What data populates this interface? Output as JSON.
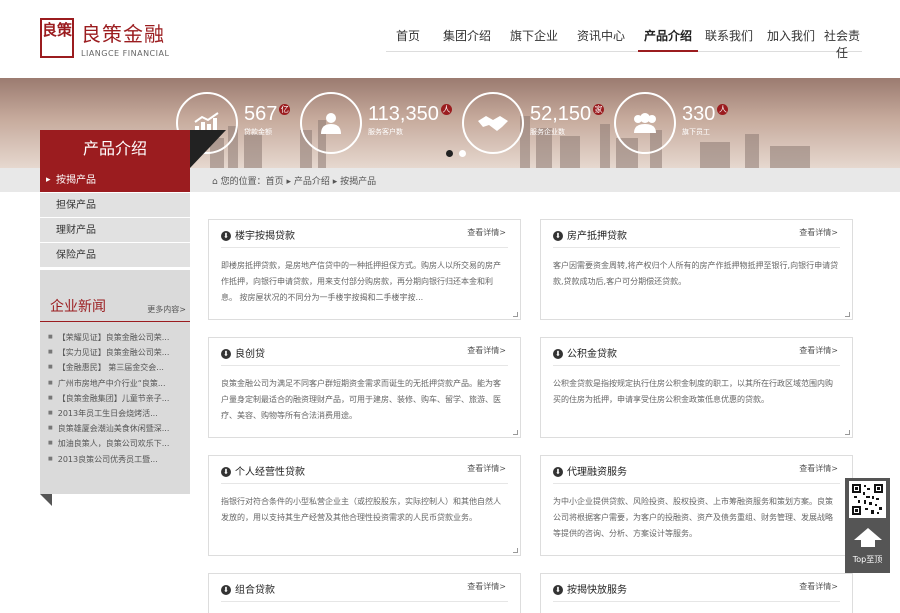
{
  "logo": {
    "seal": "良策",
    "name": "良策金融",
    "en": "LIANGCE FINANCIAL"
  },
  "nav": [
    {
      "label": "首页"
    },
    {
      "label": "集团介绍"
    },
    {
      "label": "旗下企业"
    },
    {
      "label": "资讯中心"
    },
    {
      "label": "产品介绍",
      "active": true
    },
    {
      "label": "联系我们"
    },
    {
      "label": "加入我们"
    },
    {
      "label": "社会责任"
    }
  ],
  "stats": [
    {
      "icon": "chart-icon",
      "value": "567",
      "unit": "亿",
      "label": "贷款金额"
    },
    {
      "icon": "person-icon",
      "value": "113,350",
      "unit": "人",
      "label": "服务客户数"
    },
    {
      "icon": "handshake-icon",
      "value": "52,150",
      "unit": "家",
      "label": "服务企业数"
    },
    {
      "icon": "group-icon",
      "value": "330",
      "unit": "人",
      "label": "旗下员工"
    }
  ],
  "breadcrumb": "您的位置：首页 ▸ 产品介绍 ▸ 按揭产品",
  "sidebar": {
    "title": "产品介绍",
    "items": [
      {
        "label": "按揭产品",
        "active": true
      },
      {
        "label": "担保产品"
      },
      {
        "label": "理财产品"
      },
      {
        "label": "保险产品"
      }
    ]
  },
  "news": {
    "title": "企业新闻",
    "more": "更多内容>",
    "items": [
      "【荣耀见证】良策金融公司荣...",
      "【实力见证】良策金融公司荣...",
      "【金融惠民】 第三届金交会...",
      "广州市房地产中介行业“良策...",
      "【良策金融集团】儿童节亲子...",
      "2013年员工生日会烧烤活...",
      "良策雄厦会潮汕美食休闲暨深...",
      "加油良策人，良策公司欢乐下...",
      "2013良策公司优秀员工暨..."
    ]
  },
  "cards": [
    {
      "title": "楼宇按揭贷款",
      "more": "查看详情>",
      "body": "即楼房抵押贷款，是房地产信贷中的一种抵押担保方式。购房人以所交易的房产作抵押，向银行申请贷款，用来支付部分购房款，再分期向银行归还本金和利息。 按房屋状况的不同分为一手楼宇按揭和二手楼宇按..."
    },
    {
      "title": "房产抵押贷款",
      "more": "查看详情>",
      "body": "客户因需要资金周转,将产权归个人所有的房产作抵押物抵押至银行,向银行申请贷款,贷款成功后,客户可分期偿还贷款。"
    },
    {
      "title": "良创贷",
      "more": "查看详情>",
      "body": "良策金融公司为满足不同客户群短期资金需求而诞生的无抵押贷款产品。能为客户量身定制最适合的融资理财产品，可用于建房、装修、购车、留学、旅游、医疗、美容、购物等所有合法消费用途。"
    },
    {
      "title": "公积金贷款",
      "more": "查看详情>",
      "body": "公积金贷款是指按规定执行住房公积金制度的职工，以其所在行政区域范围内购买的住房为抵押，申请享受住房公积金政策低息优惠的贷款。"
    },
    {
      "title": "个人经营性贷款",
      "more": "查看详情>",
      "body": "指银行对符合条件的小型私营企业主（或控股股东，实际控制人）和其他自然人发放的，用以支持其生产经营及其他合理性投资需求的人民币贷款业务。"
    },
    {
      "title": "代理融资服务",
      "more": "查看详情>",
      "body": "为中小企业提供贷款、风险投资、股权投资、上市筹融资服务和策划方案。良策公司将根据客户需要，为客户的投融资、资产及债务重组、财务管理、发展战略等提供的咨询、分析、方案设计等服务。"
    },
    {
      "title": "组合贷款",
      "more": "查看详情>",
      "body": ""
    },
    {
      "title": "按揭快放服务",
      "more": "查看详情>",
      "body": ""
    }
  ],
  "float": {
    "label": "Top至顶"
  }
}
